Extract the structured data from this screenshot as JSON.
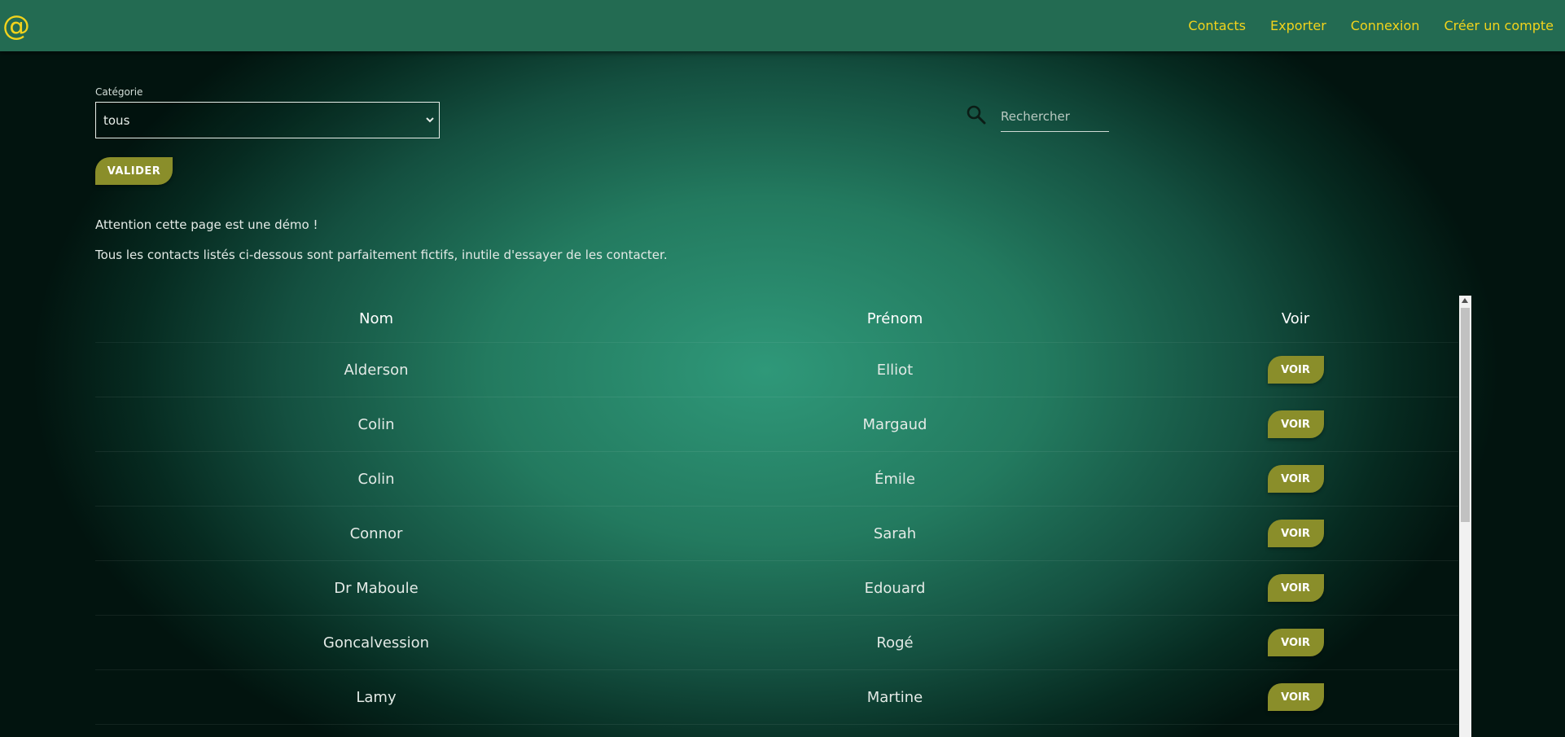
{
  "navbar": {
    "logo": "@",
    "links": [
      "Contacts",
      "Exporter",
      "Connexion",
      "Créer un compte"
    ],
    "link_color": "#f2d31c",
    "background": "#236b52"
  },
  "filter": {
    "label": "Catégorie",
    "selected": "tous",
    "submit_label": "VALIDER"
  },
  "search": {
    "placeholder": "Rechercher",
    "icon": "search-icon"
  },
  "notices": [
    "Attention cette page est une démo !",
    "Tous les contacts listés ci-dessous sont parfaitement fictifs, inutile d'essayer de les contacter."
  ],
  "table": {
    "headers": [
      "Nom",
      "Prénom",
      "Voir"
    ],
    "rows": [
      {
        "nom": "Alderson",
        "prenom": "Elliot",
        "action": "VOIR"
      },
      {
        "nom": "Colin",
        "prenom": "Margaud",
        "action": "VOIR"
      },
      {
        "nom": "Colin",
        "prenom": "Émile",
        "action": "VOIR"
      },
      {
        "nom": "Connor",
        "prenom": "Sarah",
        "action": "VOIR"
      },
      {
        "nom": "Dr Maboule",
        "prenom": "Edouard",
        "action": "VOIR"
      },
      {
        "nom": "Goncalvession",
        "prenom": "Rogé",
        "action": "VOIR"
      },
      {
        "nom": "Lamy",
        "prenom": "Martine",
        "action": "VOIR"
      }
    ]
  },
  "colors": {
    "accent_button": "#8a8e2a",
    "background_center": "#2f9879",
    "background_edge": "#02140f"
  }
}
